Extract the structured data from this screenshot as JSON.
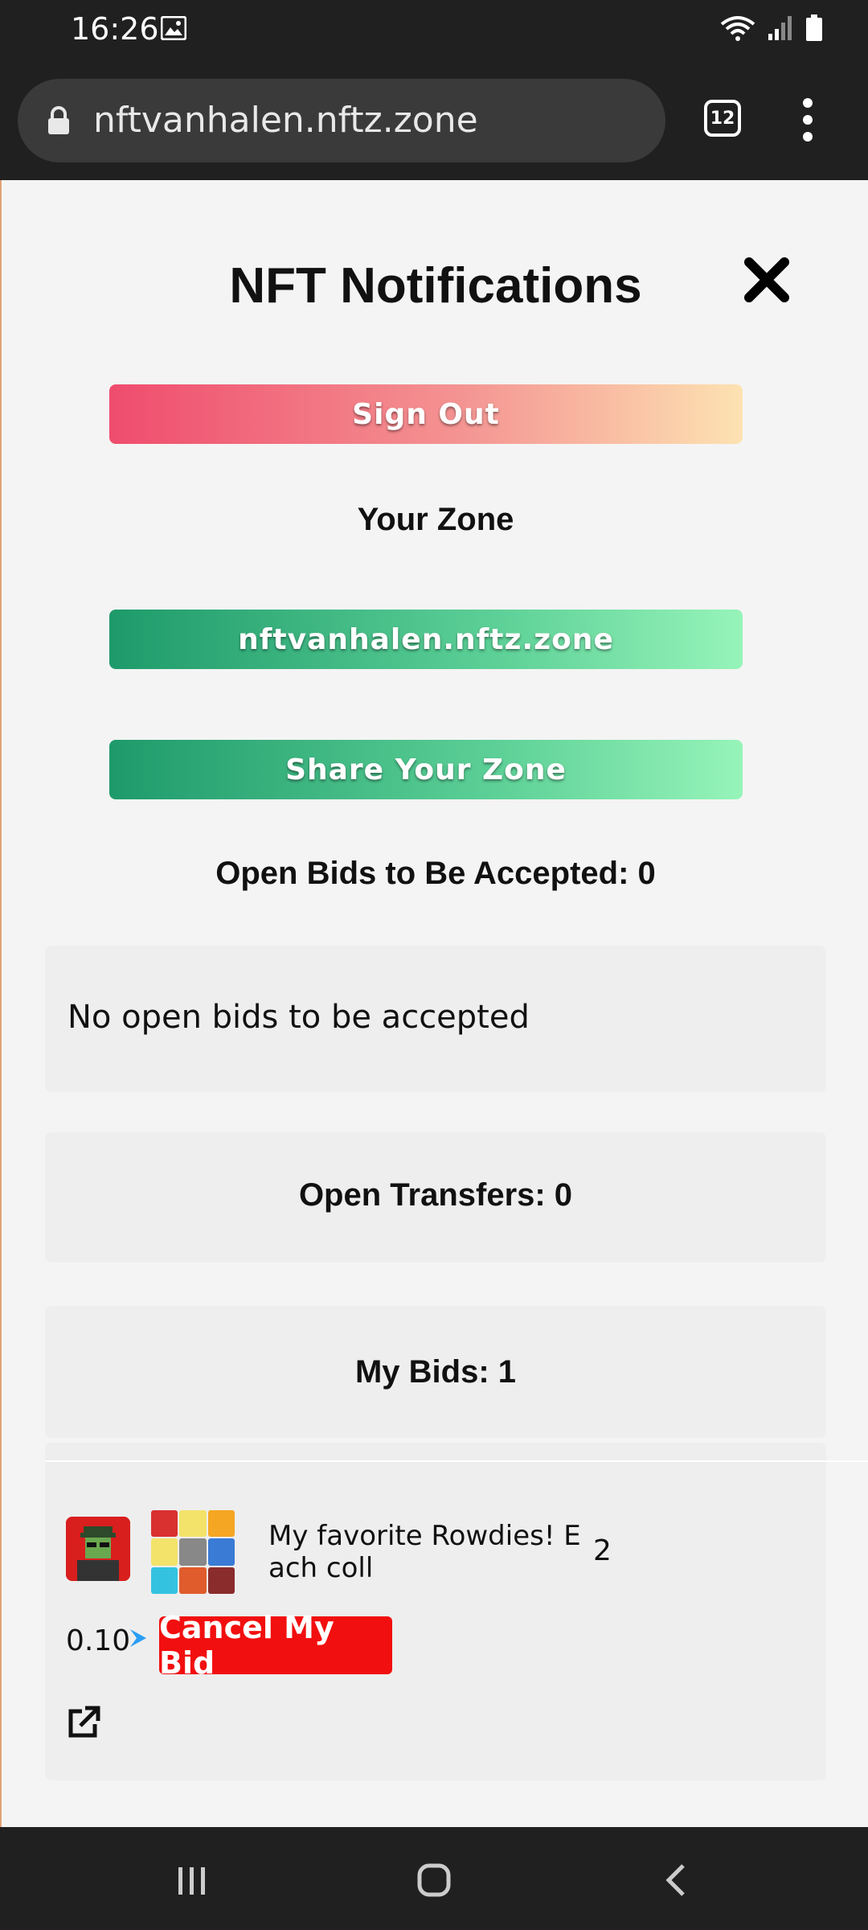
{
  "status_bar": {
    "time": "16:26"
  },
  "browser": {
    "url": "nftvanhalen.nftz.zone",
    "tab_count": "12"
  },
  "page": {
    "title": "NFT Notifications",
    "sign_out_label": "Sign Out",
    "your_zone_heading": "Your Zone",
    "zone_button_label": "nftvanhalen.nftz.zone",
    "share_zone_label": "Share Your Zone",
    "open_bids_heading": "Open Bids to Be Accepted: 0",
    "no_open_bids_text": "No open bids to be accepted",
    "open_transfers_heading": "Open Transfers: 0",
    "my_bids_heading": "My Bids: 1",
    "bid": {
      "description": "My favorite Rowdies! Each coll",
      "count": "2",
      "price": "0.10",
      "cancel_label": "Cancel My Bid"
    }
  },
  "icons": [
    "gallery-icon",
    "wifi-icon",
    "signal-icon",
    "battery-icon",
    "lock-icon",
    "tabs-icon",
    "more-vert-icon",
    "close-icon",
    "eth-icon",
    "external-link-icon",
    "recents-icon",
    "home-icon",
    "back-icon"
  ]
}
